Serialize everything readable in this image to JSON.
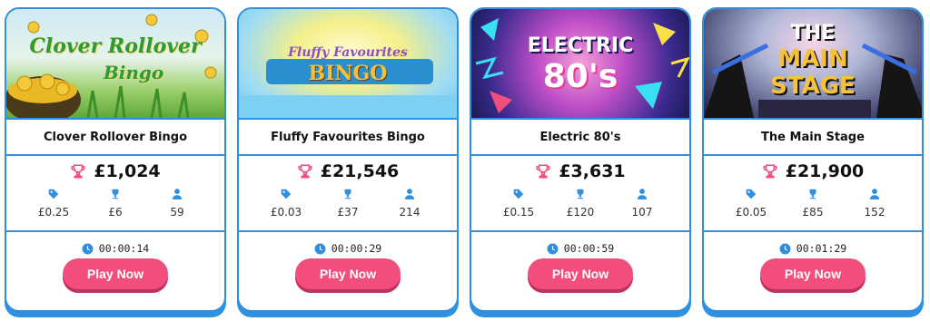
{
  "colors": {
    "card_border": "#2f8fe0",
    "play_button": "#f24e7c",
    "stat_icon": "#2f8fe0",
    "jackpot_icon": "#f24e7c"
  },
  "games": [
    {
      "name": "Clover Rollover Bingo",
      "banner_text_1": "Clover Rollover",
      "banner_text_2": "Bingo",
      "jackpot": "£1,024",
      "ticket_price": "£0.25",
      "prize": "£6",
      "players": "59",
      "timer": "00:00:14",
      "play_label": "Play Now"
    },
    {
      "name": "Fluffy Favourites Bingo",
      "banner_text_1": "Fluffy Favourites",
      "banner_text_2": "BINGO",
      "jackpot": "£21,546",
      "ticket_price": "£0.03",
      "prize": "£37",
      "players": "214",
      "timer": "00:00:29",
      "play_label": "Play Now"
    },
    {
      "name": "Electric 80's",
      "banner_text_1": "ELECTRIC",
      "banner_text_2": "80's",
      "jackpot": "£3,631",
      "ticket_price": "£0.15",
      "prize": "£120",
      "players": "107",
      "timer": "00:00:59",
      "play_label": "Play Now"
    },
    {
      "name": "The Main Stage",
      "banner_text_1": "THE",
      "banner_text_2": "MAIN",
      "banner_text_3": "STAGE",
      "jackpot": "£21,900",
      "ticket_price": "£0.05",
      "prize": "£85",
      "players": "152",
      "timer": "00:01:29",
      "play_label": "Play Now"
    }
  ]
}
